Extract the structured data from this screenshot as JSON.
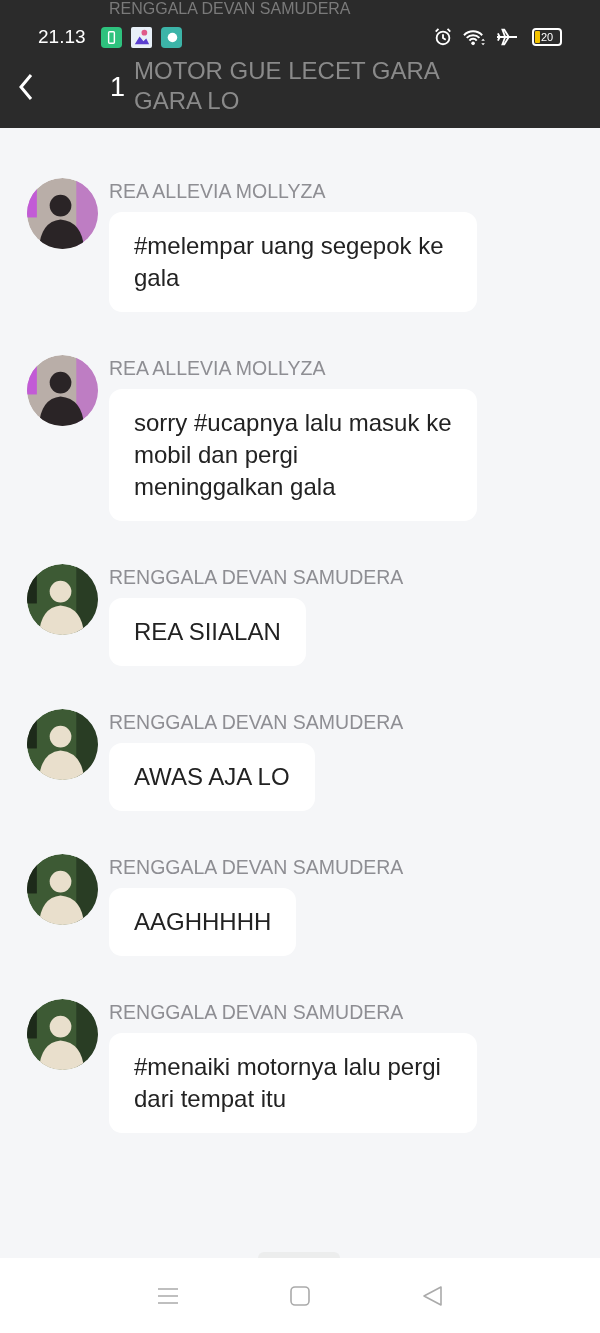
{
  "status_bar": {
    "time": "21.13",
    "battery": "20"
  },
  "header": {
    "title": "1",
    "behind": {
      "sender": "RENGGALA DEVAN SAMUDERA",
      "text": "MOTOR GUE LECET GARA GARA LO"
    }
  },
  "messages": [
    {
      "sender": "REA ALLEVIA MOLLYZA",
      "kind": "woman",
      "text": "#melempar uang segepok ke gala"
    },
    {
      "sender": "REA ALLEVIA MOLLYZA",
      "kind": "woman",
      "text": "sorry #ucapnya lalu masuk ke mobil dan pergi meninggalkan gala"
    },
    {
      "sender": "RENGGALA DEVAN SAMUDERA",
      "kind": "man",
      "text": "REA SIIALAN"
    },
    {
      "sender": "RENGGALA DEVAN SAMUDERA",
      "kind": "man",
      "text": "AWAS AJA LO"
    },
    {
      "sender": "RENGGALA DEVAN SAMUDERA",
      "kind": "man",
      "text": "AAGHHHHH"
    },
    {
      "sender": "RENGGALA DEVAN SAMUDERA",
      "kind": "man",
      "text": "#menaiki motornya lalu pergi dari tempat itu"
    }
  ]
}
